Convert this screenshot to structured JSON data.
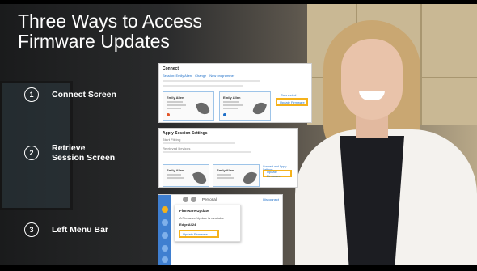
{
  "title": "Three Ways to Access Firmware Updates",
  "steps": [
    {
      "number": "1",
      "label": "Connect Screen"
    },
    {
      "number": "2",
      "label": "Retrieve\nSession Screen"
    },
    {
      "number": "3",
      "label": "Left Menu Bar"
    }
  ],
  "connect_card": {
    "heading": "Connect",
    "session_line": "Session: Emily Allen",
    "link_change": "Change",
    "link_new_programmer": "New programmer",
    "patient_left": "Emily Allen",
    "patient_right": "Emily Allen",
    "left_side_label": "Left",
    "right_side_label": "Right",
    "status": "Connected",
    "update_button": "Update Firmware"
  },
  "retrieve_card": {
    "heading": "Apply Session Settings",
    "section_one": "Start Fitting",
    "section_two": "Retrieved Devices",
    "patient_left": "Emily Allen",
    "patient_right": "Emily Allen",
    "link_text": "Connect and Apply Settings",
    "update_button": "Update Firmware"
  },
  "menu_card": {
    "top_label": "Personal",
    "disconnect_label": "Disconnect",
    "popup_title": "Firmware Update",
    "popup_subtitle": "A Firmware Update is available",
    "device_name": "Edge AI 24",
    "update_button": "Update Firmware"
  },
  "colors": {
    "highlight": "#f5b21b",
    "link": "#1e6fc8",
    "menu_bar": "#3f7fd0"
  }
}
